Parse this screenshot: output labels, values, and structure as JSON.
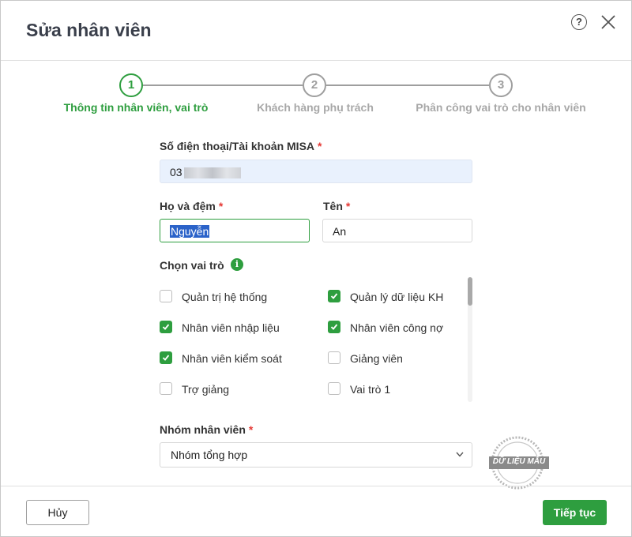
{
  "dialog": {
    "title": "Sửa nhân viên",
    "help_icon": "help-circle-icon",
    "close_icon": "close-icon"
  },
  "steps": [
    {
      "number": "1",
      "label": "Thông tin nhân viên, vai trò",
      "active": true
    },
    {
      "number": "2",
      "label": "Khách hàng phụ trách",
      "active": false
    },
    {
      "number": "3",
      "label": "Phân công vai trò cho nhân viên",
      "active": false
    }
  ],
  "form": {
    "phone_label": "Số điện thoại/Tài khoản MISA",
    "phone_value": "03",
    "lastname_label": "Họ và đệm",
    "lastname_value": "Nguyễn",
    "firstname_label": "Tên",
    "firstname_value": "An",
    "required_mark": "*",
    "roles_label": "Chọn vai trò",
    "roles": [
      {
        "label": "Quản trị hệ thống",
        "checked": false
      },
      {
        "label": "Quản lý dữ liệu KH",
        "checked": true
      },
      {
        "label": "Nhân viên nhập liệu",
        "checked": true
      },
      {
        "label": "Nhân viên công nợ",
        "checked": true
      },
      {
        "label": "Nhân viên kiểm soát",
        "checked": true
      },
      {
        "label": "Giảng viên",
        "checked": false
      },
      {
        "label": "Trợ giảng",
        "checked": false
      },
      {
        "label": "Vai trò 1",
        "checked": false
      }
    ],
    "group_label": "Nhóm nhân viên",
    "group_value": "Nhóm tổng hợp"
  },
  "watermark": {
    "text": "DỮ LIỆU MẪU"
  },
  "footer": {
    "cancel_label": "Hủy",
    "next_label": "Tiếp tục"
  },
  "colors": {
    "accent": "#2e9e3f",
    "required": "#e53935",
    "inactive_step": "#9e9e9e"
  }
}
